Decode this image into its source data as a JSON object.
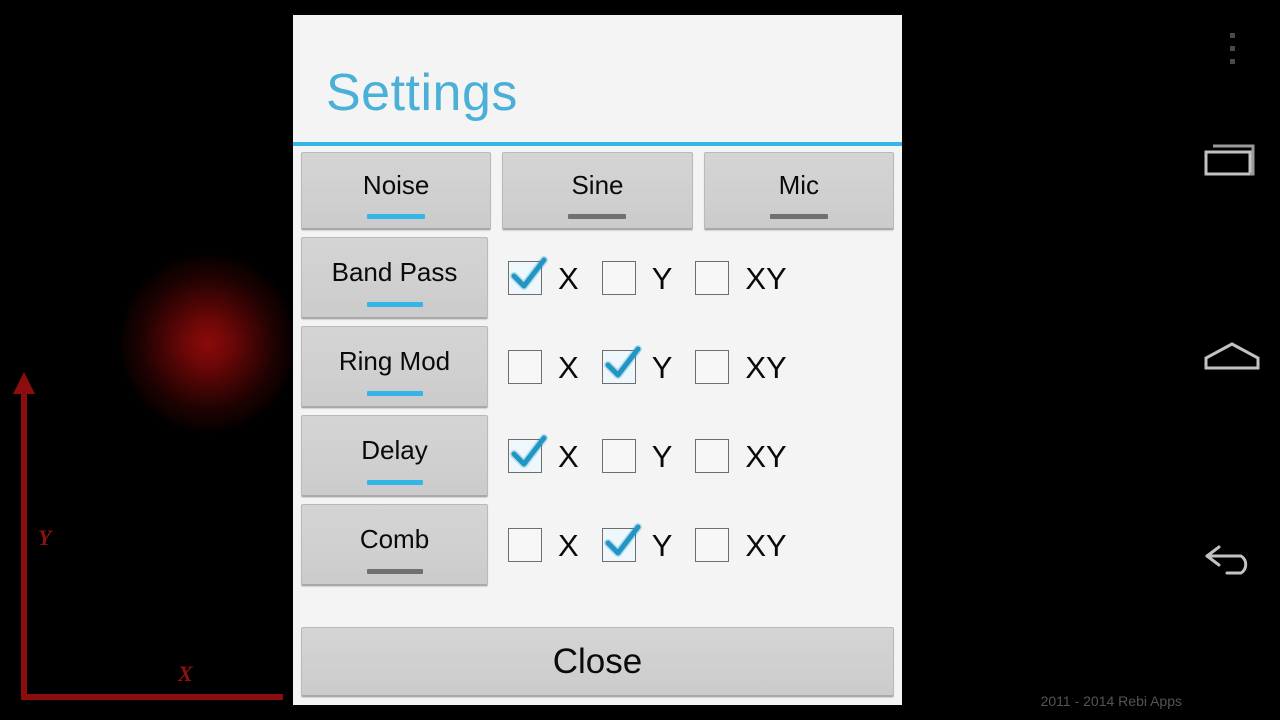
{
  "app": {
    "copyright": "2011 - 2014 Rebi Apps",
    "accent_color": "#33b5e5",
    "inactive_color": "#707070",
    "axis_color": "#8B0D0D",
    "dialog_bg": "#f4f4f4",
    "button_bg": "#d0d0d0"
  },
  "visualizer": {
    "y_axis_label": "Y",
    "x_axis_label": "X"
  },
  "navbar": {
    "menu_icon": "overflow-menu-icon",
    "recents_icon": "recent-apps-icon",
    "home_icon": "home-icon",
    "back_icon": "back-icon"
  },
  "dialog": {
    "title": "Settings",
    "close_label": "Close",
    "sources": [
      {
        "label": "Noise",
        "active": true
      },
      {
        "label": "Sine",
        "active": false
      },
      {
        "label": "Mic",
        "active": false
      }
    ],
    "effects": [
      {
        "label": "Band Pass",
        "active": true,
        "axes": [
          {
            "label": "X",
            "checked": true
          },
          {
            "label": "Y",
            "checked": false
          },
          {
            "label": "XY",
            "checked": false
          }
        ]
      },
      {
        "label": "Ring Mod",
        "active": true,
        "axes": [
          {
            "label": "X",
            "checked": false
          },
          {
            "label": "Y",
            "checked": true
          },
          {
            "label": "XY",
            "checked": false
          }
        ]
      },
      {
        "label": "Delay",
        "active": true,
        "axes": [
          {
            "label": "X",
            "checked": true
          },
          {
            "label": "Y",
            "checked": false
          },
          {
            "label": "XY",
            "checked": false
          }
        ]
      },
      {
        "label": "Comb",
        "active": false,
        "axes": [
          {
            "label": "X",
            "checked": false
          },
          {
            "label": "Y",
            "checked": true
          },
          {
            "label": "XY",
            "checked": false
          }
        ]
      }
    ]
  }
}
